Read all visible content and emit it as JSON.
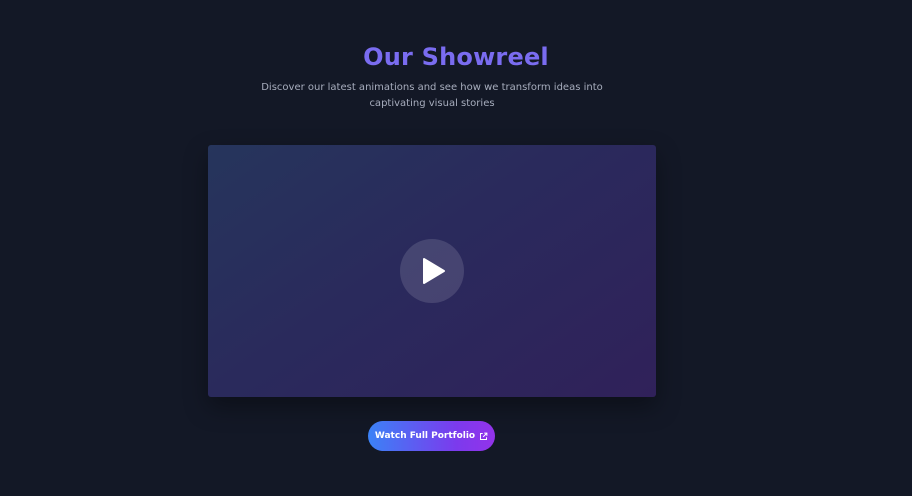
{
  "header": {
    "title": "Our Showreel",
    "subtitle": "Discover our latest animations and see how we transform ideas into captivating visual stories"
  },
  "video": {
    "play_icon": "play-icon"
  },
  "cta": {
    "label": "Watch Full Portfolio",
    "icon": "external-link-icon"
  },
  "colors": {
    "background": "#131826",
    "title": "#7a6cf0",
    "button_gradient_start": "#3b82f6",
    "button_gradient_end": "#9333ea"
  }
}
